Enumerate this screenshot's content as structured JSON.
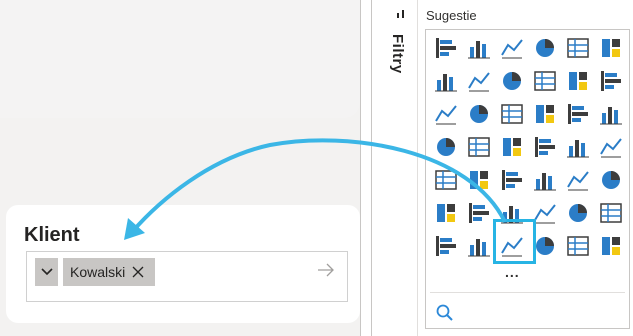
{
  "canvas": {
    "slicer": {
      "title": "Klient",
      "tag_value": "Kowalski"
    }
  },
  "filters_pane": {
    "label": "Filtry"
  },
  "visualizations": {
    "section_title": "Sugestie",
    "more_label": "...",
    "icons": [
      "stacked-bar-chart-icon",
      "stacked-column-chart-icon",
      "clustered-bar-chart-icon",
      "clustered-column-chart-icon",
      "100-percent-stacked-bar-icon",
      "100-percent-stacked-column-icon",
      "line-chart-icon",
      "area-chart-icon",
      "stacked-area-chart-icon",
      "line-stacked-column-icon",
      "line-clustered-column-icon",
      "ribbon-chart-icon",
      "waterfall-chart-icon",
      "funnel-chart-icon",
      "scatter-chart-icon",
      "pie-chart-icon",
      "donut-chart-icon",
      "treemap-icon",
      "map-icon",
      "filled-map-icon",
      "shape-map-icon",
      "azure-map-icon",
      "gauge-icon",
      "card-icon",
      "kpi-icon",
      "multi-row-card-icon",
      "table-icon",
      "matrix-icon",
      "r-visual-icon",
      "python-visual-icon",
      "key-influencers-icon",
      "decomposition-tree-icon",
      "qna-icon",
      "smart-narrative-icon",
      "goals-icon",
      "paginated-report-icon",
      "slicer-icon",
      "text-slicer-icon",
      "image-icon",
      "custom-visual-icon",
      "power-apps-icon",
      "power-automate-icon"
    ]
  },
  "colors": {
    "accent": "#27b4e4",
    "chart_blue": "#2b7dc7",
    "chart_dark": "#3d3d3d",
    "chart_yellow": "#f2c811"
  }
}
